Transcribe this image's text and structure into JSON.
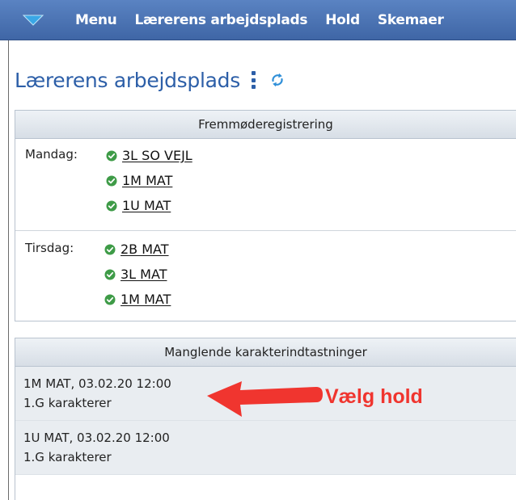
{
  "nav": {
    "items": [
      "Menu",
      "Lærerens arbejdsplads",
      "Hold",
      "Skemaer"
    ],
    "dropdown_icon": "triangle-down-icon"
  },
  "page": {
    "title": "Lærerens arbejdsplads",
    "menu_icon": "kebab-icon",
    "refresh_icon": "refresh-icon"
  },
  "attendance": {
    "header": "Fremmøderegistrering",
    "days": [
      {
        "label": "Mandag:",
        "classes": [
          "3L SO VEJL",
          "1M MAT",
          "1U MAT"
        ]
      },
      {
        "label": "Tirsdag:",
        "classes": [
          "2B MAT",
          "3L MAT",
          "1M MAT"
        ]
      }
    ],
    "check_color": "#3e9b47"
  },
  "grades": {
    "header": "Manglende karakterindtastninger",
    "entries": [
      {
        "line1": "1M MAT, 03.02.20 12:00",
        "line2": "1.G karakterer"
      },
      {
        "line1": "1U MAT, 03.02.20 12:00",
        "line2": "1.G karakterer"
      }
    ]
  },
  "annotation": {
    "text": "Vælg hold",
    "color": "#f0352f"
  }
}
